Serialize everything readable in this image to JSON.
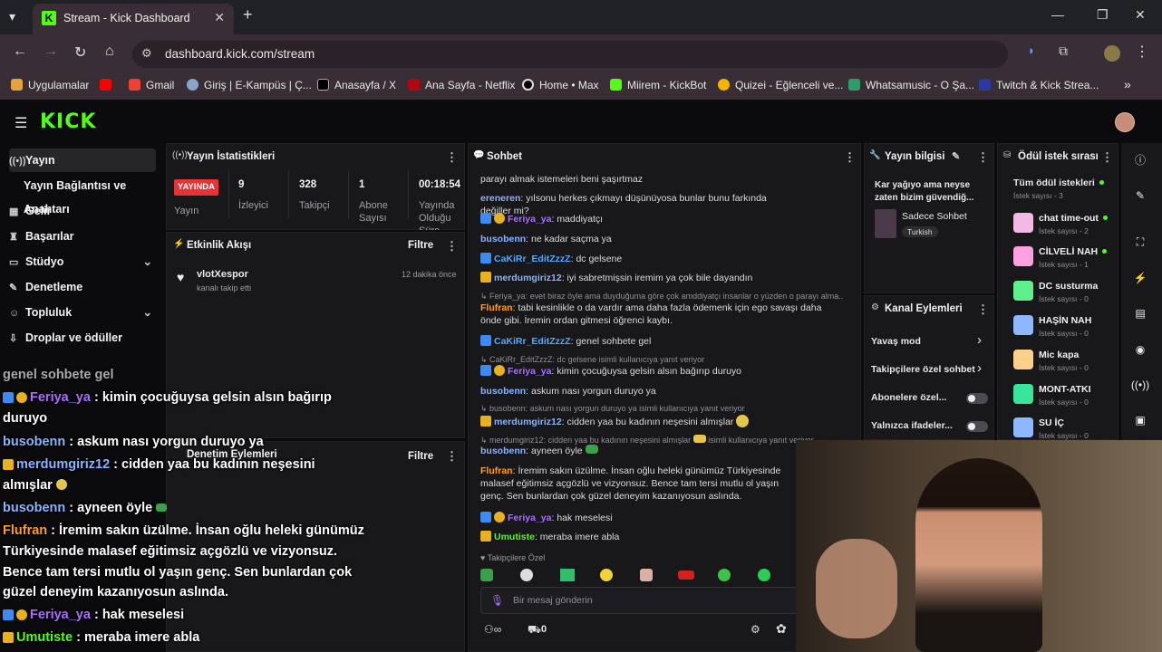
{
  "browser": {
    "tab_title": "Stream - Kick Dashboard",
    "url": "dashboard.kick.com/stream",
    "bookmarks": [
      "Uygulamalar",
      "Gmail",
      "Giriş | E-Kampüs | Ç...",
      "Anasayfa / X",
      "Ana Sayfa - Netflix",
      "Home • Max",
      "Miirem - KickBot",
      "Quizei - Eğlenceli ve...",
      "Whatsamusic - O Şa...",
      "Twitch & Kick Strea..."
    ]
  },
  "sidebar": {
    "items": [
      "Yayın",
      "Yayın Bağlantısı ve Anahtarı",
      "Gelir",
      "Başarılar",
      "Stüdyo",
      "Denetleme",
      "Topluluk",
      "Droplar ve ödüller"
    ]
  },
  "stats": {
    "title": "Yayın İstatistikleri",
    "live_badge": "YAYINDA",
    "stream_label": "Yayın",
    "viewers": "9",
    "viewers_label": "İzleyici",
    "followers": "328",
    "followers_label": "Takipçi",
    "subs": "1",
    "subs_label": "Abone Sayısı",
    "uptime": "00:18:54",
    "uptime_label": "Yayında Olduğu Süre"
  },
  "activity": {
    "title": "Etkinlik Akışı",
    "filter": "Filtre",
    "user": "vlotXespor",
    "action": "kanalı takip etti",
    "time": "12 dakika önce"
  },
  "moderation": {
    "title": "Denetim Eylemleri",
    "filter": "Filtre"
  },
  "chat": {
    "title": "Sohbet",
    "lines": [
      {
        "user": "",
        "text": "parayı almak istemeleri beni şaşırtmaz"
      },
      {
        "user": "ereneren",
        "text": "yılsonu herkes çıkmayı düşünüyosa bunlar bunu farkında değiller mi?"
      },
      {
        "user": "Feriya_ya",
        "text": "maddiyatçı"
      },
      {
        "user": "busobenn",
        "text": "ne kadar saçma ya"
      },
      {
        "user": "CaKiRr_EditZzzZ",
        "text": "dc gelsene"
      },
      {
        "user": "merdumgiriz12",
        "text": "iyi sabretmişsin iremim ya çok bile dayandın"
      },
      {
        "user": "Flufran",
        "text": "tabi kesinlikle o da vardır ama daha fazla ödemenk için ego savaşı daha önde gibi. İremin ordan gitmesi öğrenci kaybı."
      },
      {
        "user": "CaKiRr_EditZzzZ",
        "text": "genel sohbete gel"
      },
      {
        "user": "Feriya_ya",
        "text": "kimin çocuğuysa gelsin alsın bağırıp duruyo"
      },
      {
        "user": "busobenn",
        "text": "askum nası yorgun duruyo ya"
      },
      {
        "user": "merdumgiriz12",
        "text": "cidden yaa bu kadının neşesini almışlar"
      },
      {
        "user": "busobenn",
        "text": "ayneen öyle"
      },
      {
        "user": "Flufran",
        "text": "İremim sakın üzülme. İnsan oğlu heleki günümüz Türkiyesinde malasef eğitimsiz açgözlü ve vizyonsuz. Bence tam tersi mutlu ol yaşın genç. Sen bunlardan çok güzel deneyim kazanıyosun aslında."
      },
      {
        "user": "Feriya_ya",
        "text": "hak meselesi"
      },
      {
        "user": "Umutiste",
        "text": "meraba imere abla"
      }
    ],
    "replies": [
      "Feriya_ya: evet biraz öyle ama duyduğuma göre çok amddiyatçı insanlar o yüzden o parayı alma...",
      "CaKiRr_EditZzzZ: dc gelsene isimli kullanıcıya yanıt veriyor",
      "busobenn: askum nası yorgun duruyo ya isimli kullanıcıya yanıt veriyor",
      "merdumgiriz12: cidden yaa bu kadının neşesini almışlar",
      "isimli kullanıcıya yanıt veriyor"
    ],
    "followers_only": "Takipçilere Özel",
    "input_placeholder": "Bir mesaj gönderin",
    "points": "0"
  },
  "stream_info": {
    "title": "Yayın bilgisi",
    "stream_title": "Kar yağıyo ama neyse zaten bizim güvendiğ...",
    "category": "Sadece Sohbet",
    "tag": "Turkish"
  },
  "channel_actions": {
    "title": "Kanal Eylemleri",
    "items": [
      "Yavaş mod",
      "Takipçilere özel sohbet",
      "Abonelere özel...",
      "Yalnızca ifadeler..."
    ]
  },
  "rewards": {
    "title": "Ödül istek sırası",
    "all": "Tüm ödül istekleri",
    "all_count": "İstek sayısı - 3",
    "items": [
      {
        "name": "chat time-out",
        "count": "İstek sayısı - 2",
        "dot": true,
        "color": "#f3b8e6"
      },
      {
        "name": "CİLVELİ NAH",
        "count": "İstek sayısı - 1",
        "dot": true,
        "color": "#ff9ee0"
      },
      {
        "name": "DC susturma",
        "count": "İstek sayısı - 0",
        "dot": false,
        "color": "#5ef08a"
      },
      {
        "name": "HAŞİN NAH",
        "count": "İstek sayısı - 0",
        "dot": false,
        "color": "#8fb7ff"
      },
      {
        "name": "Mic kapa",
        "count": "İstek sayısı - 0",
        "dot": false,
        "color": "#ffd08a"
      },
      {
        "name": "MONT-ATKI",
        "count": "İstek sayısı - 0",
        "dot": false,
        "color": "#35e59a"
      },
      {
        "name": "SU İÇ",
        "count": "İstek sayısı - 0",
        "dot": false,
        "color": "#8fb7ff"
      }
    ]
  },
  "overlay": {
    "lines": [
      {
        "user": "",
        "text": "genel sohbete gel"
      },
      {
        "user": "Feriya_ya",
        "text": "kimin çocuğuysa gelsin alsın bağırıp"
      },
      {
        "user": "",
        "text": "duruyo"
      },
      {
        "user": "busobenn",
        "text": "askum nası yorgun duruyo ya"
      },
      {
        "user": "merdumgiriz12",
        "text": "cidden yaa bu kadının neşesini"
      },
      {
        "user": "",
        "text": "almışlar"
      },
      {
        "user": "busobenn",
        "text": "ayneen öyle"
      },
      {
        "user": "Flufran",
        "text": "İremim sakın üzülme. İnsan oğlu heleki günümüz"
      },
      {
        "user": "",
        "text": "Türkiyesinde malasef eğitimsiz açgözlü ve vizyonsuz."
      },
      {
        "user": "",
        "text": "Bence tam tersi mutlu ol yaşın genç. Sen bunlardan çok"
      },
      {
        "user": "",
        "text": "güzel deneyim kazanıyosun aslında."
      },
      {
        "user": "Feriya_ya",
        "text": "hak meselesi"
      },
      {
        "user": "Umutiste",
        "text": "meraba imere abla"
      }
    ]
  },
  "colors": {
    "kick_green": "#53fc18",
    "live_red": "#e53435",
    "feriya": "#a970ff",
    "busobenn": "#8ab4ff",
    "merdum": "#8ab4ff",
    "cakirr": "#53a8ff",
    "flufran": "#ff9d2a",
    "umutiste": "#53fc18",
    "ereneren": "#8ab4ff"
  }
}
